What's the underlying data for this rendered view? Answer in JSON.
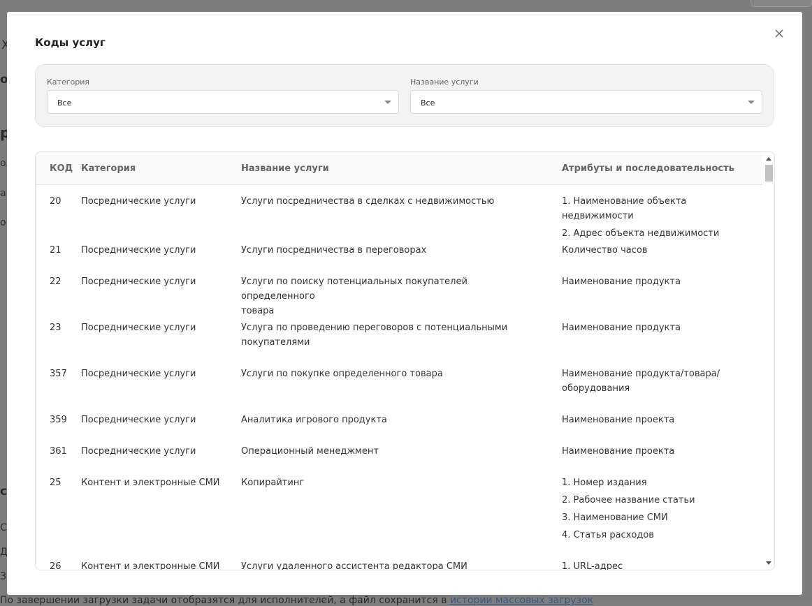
{
  "background": {
    "fragments": [
      "Х",
      "ов",
      "р",
      "ол",
      "ай",
      "ок",
      "ст",
      "С",
      "Д",
      "За"
    ],
    "footer_text": "По завершении загрузки задачи отобразятся для исполнителей, а файл сохранится в ",
    "footer_link": "истории массовых загрузок"
  },
  "modal": {
    "title": "Коды услуг",
    "close_icon": "close-icon"
  },
  "filters": {
    "category": {
      "label": "Категория",
      "value": "Все"
    },
    "service_name": {
      "label": "Название услуги",
      "value": "Все"
    }
  },
  "table": {
    "columns": [
      "КОД",
      "Категория",
      "Название услуги",
      "Атрибуты и последовательность"
    ],
    "rows": [
      {
        "code": "20",
        "category": "Посреднические услуги",
        "name": [
          "Услуги посредничества в сделках с недвижимостью"
        ],
        "attributes": [
          "1. Наименование объекта недвижимости",
          "2. Адрес объекта недвижимости"
        ]
      },
      {
        "code": "21",
        "category": "Посреднические услуги",
        "name": [
          "Услуги посредничества в переговорах"
        ],
        "attributes": [
          "Количество часов"
        ]
      },
      {
        "code": "22",
        "category": "Посреднические услуги",
        "name": [
          "Услуги по поиску потенциальных покупателей определенного",
          "товара"
        ],
        "attributes": [
          "Наименование продукта"
        ]
      },
      {
        "code": "23",
        "category": "Посреднические услуги",
        "name": [
          "Услуга по проведению переговоров с потенциальными",
          "покупателями"
        ],
        "attributes": [
          "Наименование продукта"
        ]
      },
      {
        "code": "357",
        "category": "Посреднические услуги",
        "name": [
          "Услуги по покупке определенного товара"
        ],
        "attributes": [
          "Наименование продукта/товара/",
          "оборудования"
        ]
      },
      {
        "code": "359",
        "category": "Посреднические услуги",
        "name": [
          "Аналитика игрового продукта"
        ],
        "attributes": [
          "Наименование проекта"
        ]
      },
      {
        "code": "361",
        "category": "Посреднические услуги",
        "name": [
          "Операционный менеджмент"
        ],
        "attributes": [
          "Наименование проекта"
        ]
      },
      {
        "code": "25",
        "category": "Контент и электронные СМИ",
        "name": [
          "Копирайтинг"
        ],
        "attributes": [
          "1. Номер издания",
          "2. Рабочее название статьи",
          "3. Наименование СМИ",
          "4. Статья расходов"
        ]
      },
      {
        "code": "26",
        "category": "Контент и электронные СМИ",
        "name": [
          "Услуги удаленного ассистента редактора СМИ"
        ],
        "attributes": [
          "1. URL-адрес"
        ]
      }
    ]
  },
  "colors": {
    "overlay": "#7f7f7f",
    "modal_bg": "#ffffff",
    "filter_panel_bg": "#f3f3f3",
    "header_text": "#666666",
    "body_text": "#333333"
  }
}
